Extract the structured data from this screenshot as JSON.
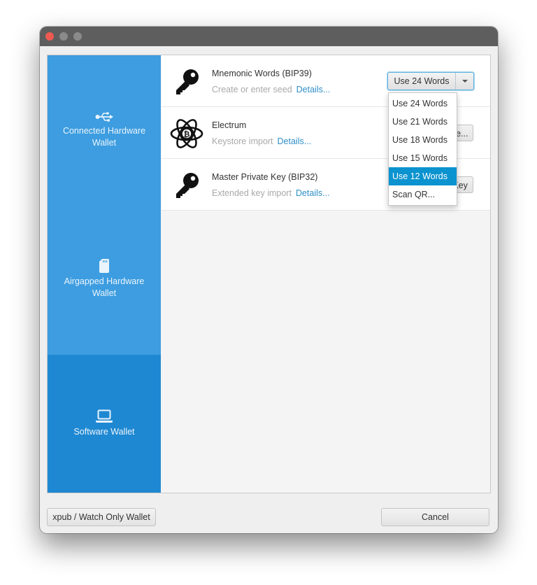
{
  "window": {
    "traffic_lights": [
      "close",
      "minimize",
      "zoom"
    ]
  },
  "sidebar": {
    "items": [
      {
        "label": "Connected Hardware Wallet",
        "icon": "usb-icon",
        "selected": false
      },
      {
        "label": "Airgapped Hardware Wallet",
        "icon": "sd-card-icon",
        "selected": false
      },
      {
        "label": "Software Wallet",
        "icon": "laptop-icon",
        "selected": true
      }
    ],
    "colors": {
      "normal": "#3d9de0",
      "selected": "#1f88d2"
    }
  },
  "rows": [
    {
      "title": "Mnemonic Words (BIP39)",
      "subtitle": "Create or enter seed",
      "link": "Details...",
      "icon": "key-icon",
      "action": "Use 24 Words"
    },
    {
      "title": "Electrum",
      "subtitle": "Keystore import",
      "link": "Details...",
      "icon": "electrum-bitcoin-icon",
      "action": "Import File..."
    },
    {
      "title": "Master Private Key (BIP32)",
      "subtitle": "Extended key import",
      "link": "Details...",
      "icon": "key-icon",
      "action": "Enter Key"
    }
  ],
  "dropdown": {
    "selected": "Use 24 Words",
    "options": [
      "Use 24 Words",
      "Use 21 Words",
      "Use 18 Words",
      "Use 15 Words",
      "Use 12 Words",
      "Scan QR..."
    ],
    "highlighted_index": 4
  },
  "footer": {
    "watch_only_label": "xpub / Watch Only Wallet",
    "cancel_label": "Cancel"
  }
}
